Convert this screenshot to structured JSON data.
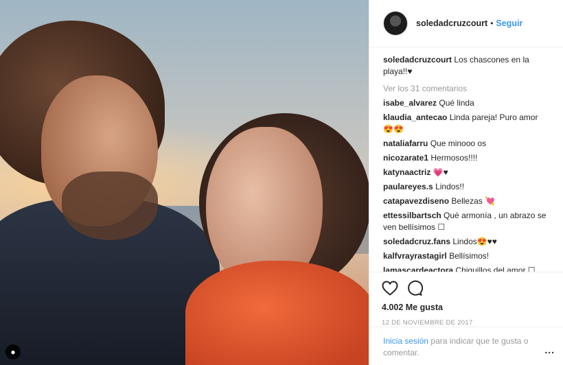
{
  "post": {
    "username": "soledadcruzcourt",
    "follow_label": "Seguir",
    "separator": "•",
    "caption": "Los chascones en la playa!!",
    "caption_emoji": "♥"
  },
  "comments": {
    "view_all_label": "Ver los 31 comentarios",
    "items": [
      {
        "user": "isabe_alvarez",
        "text": "Qué linda"
      },
      {
        "user": "klaudia_antecao",
        "text": "Linda pareja! Puro amor 😍😍"
      },
      {
        "user": "nataliafarru",
        "text": "Que minooo os"
      },
      {
        "user": "nicozarate1",
        "text": "Hermosos!!!!"
      },
      {
        "user": "katynaactriz",
        "text": "💗♥"
      },
      {
        "user": "paulareyes.s",
        "text": "Lindos!!"
      },
      {
        "user": "catapavezdiseno",
        "text": "Bellezas 💘"
      },
      {
        "user": "ettessilbartsch",
        "text": "Qué armonía , un abrazo se ven bellísimos ☐"
      },
      {
        "user": "soledadcruz.fans",
        "text": "Lindos😍♥♥"
      },
      {
        "user": "kalfvrayrastagirl",
        "text": "Bellísimos!"
      },
      {
        "user": "lamascardeactora",
        "text": "Chiquillos del amor ☐"
      }
    ]
  },
  "actions": {
    "like_icon": "heart-icon",
    "comment_icon": "comment-icon",
    "likes": "4.002 Me gusta",
    "date": "12 DE NOVIEMBRE DE 2017"
  },
  "login": {
    "link": "Inicia sesión",
    "text": "para indicar que te gusta o comentar.",
    "more": "..."
  },
  "colors": {
    "link": "#3897f0",
    "muted": "#999999",
    "text": "#262626"
  }
}
